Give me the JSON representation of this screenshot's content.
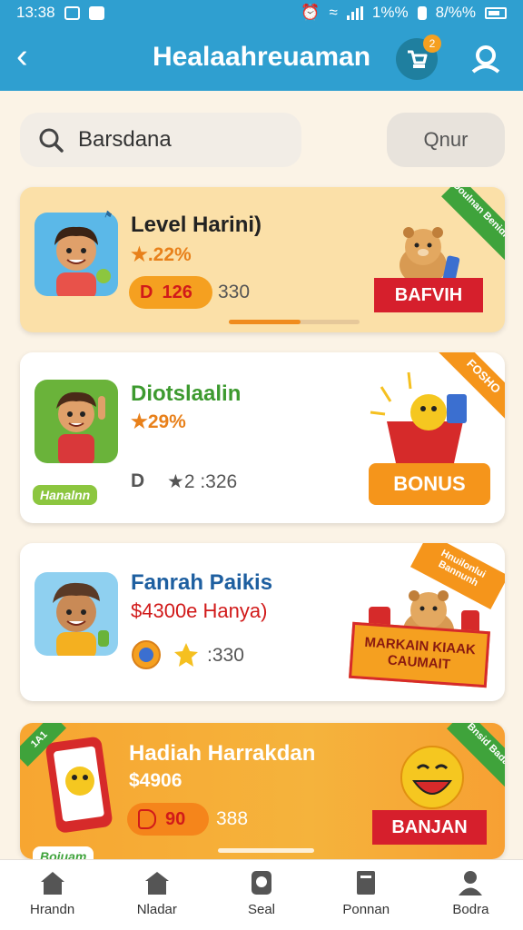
{
  "status": {
    "time": "13:38",
    "battery_a": "1%%",
    "battery_b": "8/%%"
  },
  "header": {
    "title": "Healaahreuaman",
    "cart_badge": "2"
  },
  "search": {
    "value": "Barsdana",
    "button": "Qnur"
  },
  "cards": [
    {
      "title": "Level Harini)",
      "rating": "★.22%",
      "pill_value": "126",
      "pill_prefix": "D",
      "stat": "330",
      "ribbon": "BAFVIH",
      "corner": "Doulnan Benidiaan",
      "progress": 0.55,
      "title_color": "#222222"
    },
    {
      "title": "Diotslaalin",
      "rating": "★29%",
      "stat_a": "D",
      "stat": "★2 :326",
      "ribbon": "BONUS",
      "corner": "FOSHO",
      "mini": "Hanalnn",
      "title_color": "#3d9a2f"
    },
    {
      "title": "Fanrah Paikis",
      "subtitle": "$4300e Hanya)",
      "stat": ":330",
      "banner": "MARKAIN KIAAK CAUMAIT",
      "flag": "Hnuilonlui Bannunh",
      "title_color": "#1e5fa0"
    },
    {
      "title": "Hadiah Harrakdan",
      "rating": "$4906",
      "pill_value": "90",
      "stat": "388",
      "ribbon": "BANJAN",
      "corner": "Bnsid Badarn",
      "corner_left": "1A1",
      "mini": "Boiuam",
      "title_color": "#ffffff"
    }
  ],
  "nav": [
    {
      "label": "Hrandn",
      "icon": "home-icon"
    },
    {
      "label": "Nladar",
      "icon": "shop-icon"
    },
    {
      "label": "Seal",
      "icon": "search-icon"
    },
    {
      "label": "Ponnan",
      "icon": "document-icon"
    },
    {
      "label": "Bodra",
      "icon": "profile-icon"
    }
  ]
}
